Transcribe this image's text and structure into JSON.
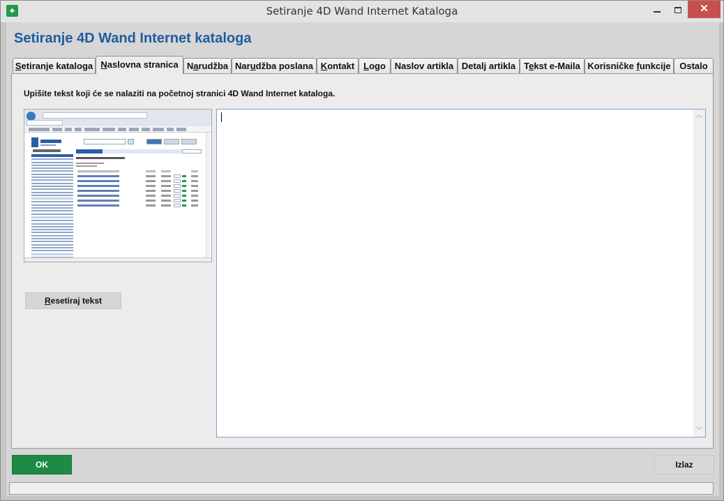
{
  "window": {
    "title": "Setiranje 4D Wand Internet Kataloga",
    "minimize_label": "—",
    "close_label": "✕"
  },
  "header": {
    "title": "Setiranje 4D Wand Internet kataloga"
  },
  "tabs": [
    {
      "label": "Setiranje kataloga",
      "access_key": "S",
      "active": false
    },
    {
      "label": "Naslovna stranica",
      "access_key": "N",
      "active": true
    },
    {
      "label": "Narudžba",
      "access_key": "a",
      "active": false
    },
    {
      "label": "Narudžba poslana",
      "access_key": "u",
      "active": false
    },
    {
      "label": "Kontakt",
      "access_key": "K",
      "active": false
    },
    {
      "label": "Logo",
      "access_key": "L",
      "active": false
    },
    {
      "label": "Naslov artikla",
      "access_key": "",
      "active": false
    },
    {
      "label": "Detalj artikla",
      "access_key": "",
      "active": false
    },
    {
      "label": "Tekst e-Maila",
      "access_key": "e",
      "active": false
    },
    {
      "label": "Korisničke funkcije",
      "access_key": "f",
      "active": false
    },
    {
      "label": "Ostalo",
      "access_key": "",
      "active": false
    }
  ],
  "panel": {
    "instruction": "Upišite tekst koji će se nalaziti na početnoj stranici 4D Wand Internet kataloga.",
    "reset_button": "Resetiraj tekst",
    "text_value": ""
  },
  "footer": {
    "ok_button": "OK",
    "exit_button": "Izlaz"
  },
  "colors": {
    "header_title": "#1f5b9e",
    "ok_button": "#1e8a45",
    "close_button": "#c7504f"
  }
}
